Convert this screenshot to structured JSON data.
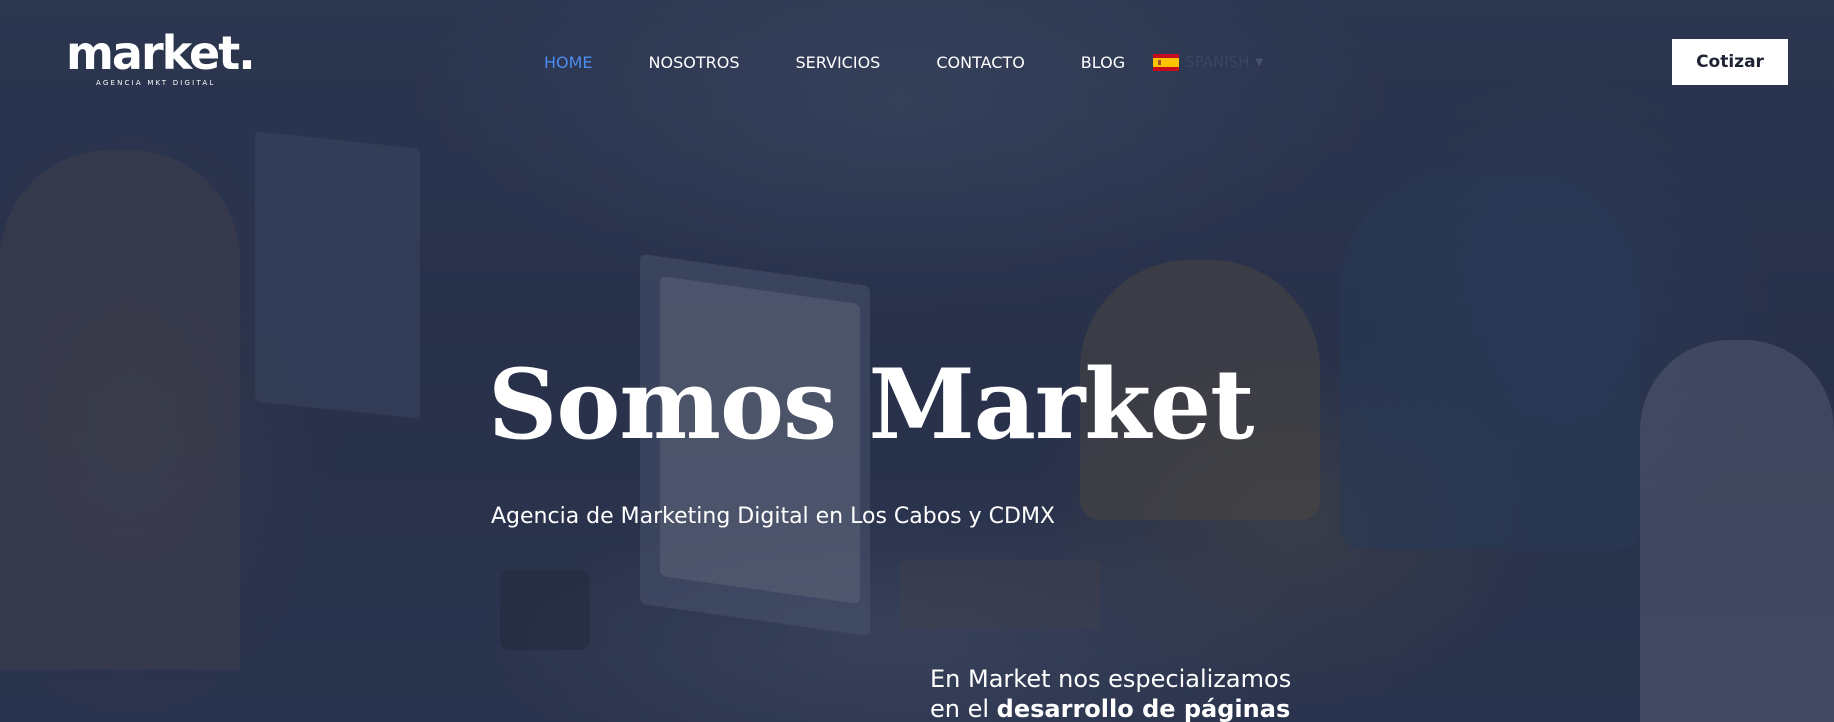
{
  "header": {
    "logo": {
      "wordmark": "market.",
      "tagline": "AGENCIA MKT DIGITAL"
    },
    "nav": {
      "items": [
        {
          "label": "HOME",
          "active": true
        },
        {
          "label": "NOSOTROS",
          "active": false
        },
        {
          "label": "SERVICIOS",
          "active": false
        },
        {
          "label": "CONTACTO",
          "active": false
        },
        {
          "label": "BLOG",
          "active": false
        }
      ],
      "language": {
        "flag_icon": "spain-flag-icon",
        "label": "SPANISH",
        "caret_icon": "caret-down-icon"
      }
    },
    "cta_label": "Cotizar"
  },
  "hero": {
    "title": "Somos Market",
    "subtitle": "Agencia de Marketing Digital en Los Cabos y CDMX",
    "body_line1": "En Market nos especializamos",
    "body_line2_prefix": "en el ",
    "body_line2_bold": "desarrollo de páginas"
  },
  "colors": {
    "accent_active_nav": "#4a8df2",
    "overlay": "#202840",
    "cta_background": "#ffffff",
    "cta_text": "#1e2235"
  }
}
